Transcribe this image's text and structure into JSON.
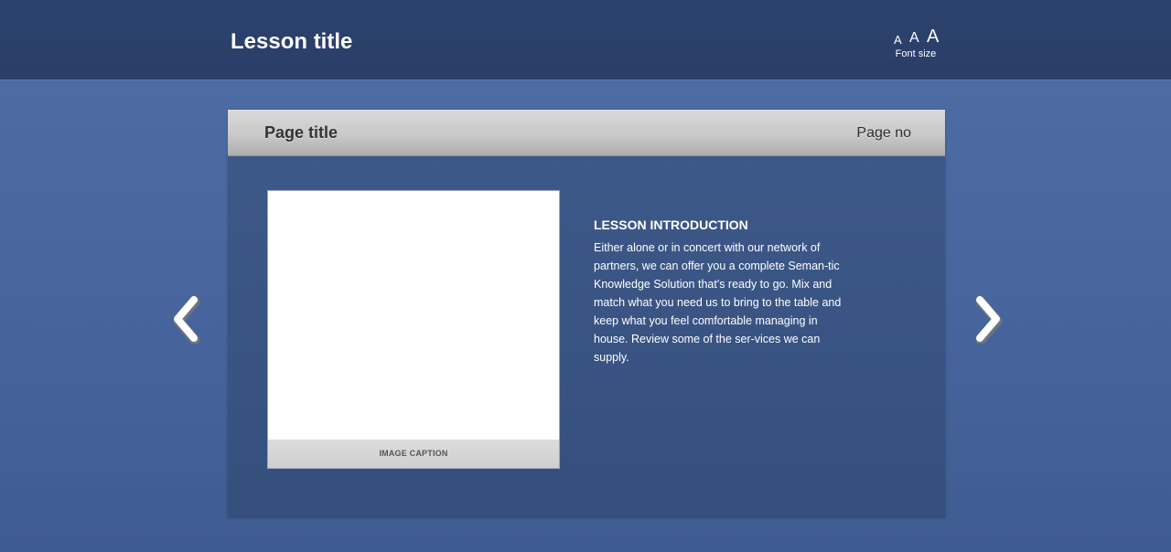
{
  "header": {
    "lesson_title": "Lesson title",
    "font_size": {
      "small_label": "A",
      "medium_label": "A",
      "large_label": "A",
      "caption": "Font size"
    }
  },
  "page": {
    "title": "Page title",
    "page_no": "Page no"
  },
  "image": {
    "caption": "IMAGE CAPTION"
  },
  "intro": {
    "heading": "LESSON INTRODUCTION",
    "body": "Either alone or in concert with our network of partners, we can offer you a complete Seman-tic Knowledge Solution that's ready to go. Mix and match what you need us to bring to the table and keep what you feel comfortable managing in house. Review some of the ser-vices we can supply."
  },
  "navigation": {
    "prev_icon": "chevron-left-icon",
    "next_icon": "chevron-right-icon"
  },
  "colors": {
    "header_bg": "#2c416d",
    "page_bg": "#4a68a0",
    "panel_bg": "#3a5586",
    "panel_header_bg": "#c9c9c9"
  }
}
